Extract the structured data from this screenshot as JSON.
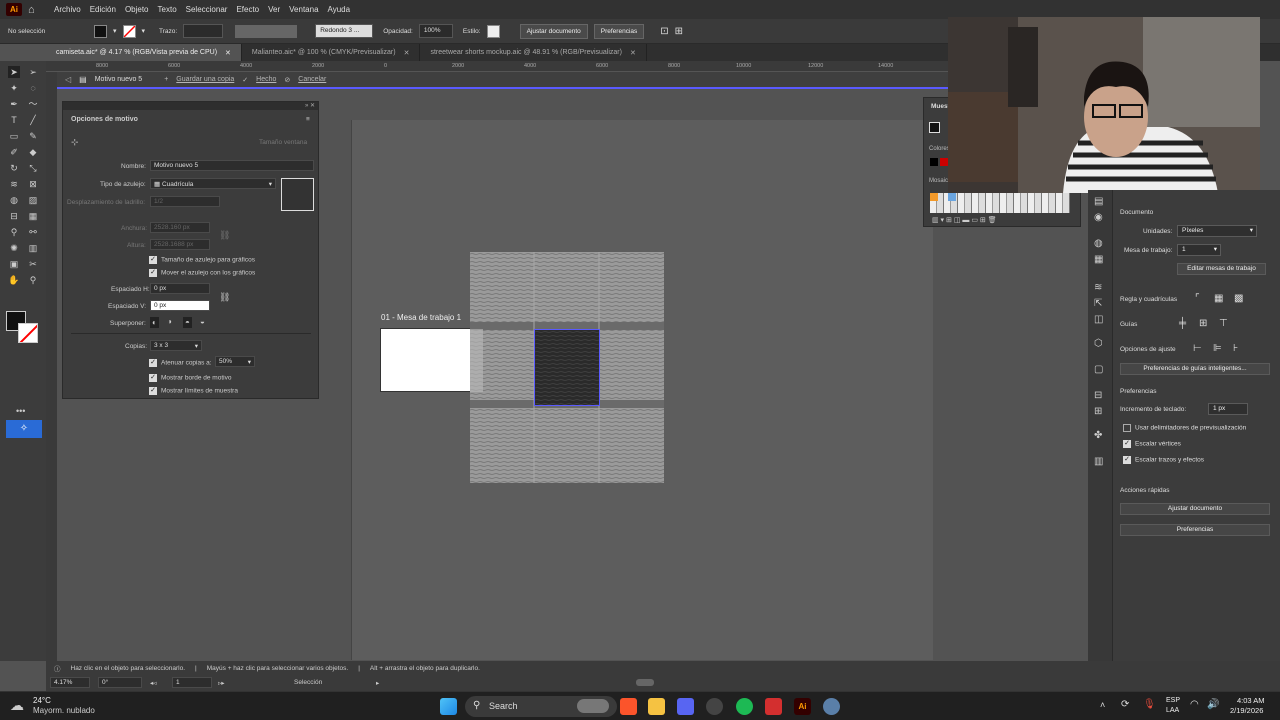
{
  "app": {
    "logo": "Ai"
  },
  "menu": [
    "Archivo",
    "Edición",
    "Objeto",
    "Texto",
    "Seleccionar",
    "Efecto",
    "Ver",
    "Ventana",
    "Ayuda"
  ],
  "control_bar": {
    "selection": "No selección",
    "stroke_label": "Trazo:",
    "brush": "Redondo 3 ...",
    "opacity_label": "Opacidad:",
    "opacity_value": "100%",
    "style_label": "Estilo:",
    "fit_doc": "Ajustar documento",
    "prefs": "Preferencias"
  },
  "tabs": [
    {
      "label": "camiseta.aic* @ 4.17 % (RGB/Vista previa de CPU)",
      "active": true
    },
    {
      "label": "Malianteo.aic* @ 100 % (CMYK/Previsualizar)",
      "active": false
    },
    {
      "label": "streetwear shorts mockup.aic @ 48.91 % (RGB/Previsualizar)",
      "active": false
    }
  ],
  "ruler_ticks": [
    "8000",
    "6000",
    "4000",
    "2000",
    "0",
    "2000",
    "4000",
    "6000",
    "8000",
    "10000",
    "12000",
    "14000"
  ],
  "isolation": {
    "title": "Motivo nuevo 5",
    "save_copy": "Guardar una copia",
    "done": "Hecho",
    "cancel": "Cancelar"
  },
  "pattern_options": {
    "title": "Opciones de motivo",
    "fit_label": "Tamaño ventana",
    "name_label": "Nombre:",
    "name_value": "Motivo nuevo 5",
    "tile_type_label": "Tipo de azulejo:",
    "tile_type_value": "Cuadrícula",
    "brick_offset_label": "Desplazamiento de ladrillo:",
    "brick_offset_value": "1/2",
    "width_label": "Anchura:",
    "width_value": "2528.160 px",
    "height_label": "Altura:",
    "height_value": "2528.1688 px",
    "size_to_art": "Tamaño de azulejo para gráficos",
    "move_tile": "Mover el azulejo con los gráficos",
    "h_spacing_label": "Espaciado H:",
    "h_spacing_value": "0 px",
    "v_spacing_label": "Espaciado V:",
    "v_spacing_value": "0 px",
    "overlap_label": "Superponer:",
    "copies_label": "Copias:",
    "copies_value": "3 x 3",
    "dim_copies": "Atenuar copias a:",
    "dim_value": "50%",
    "show_tile_edge": "Mostrar borde de motivo",
    "show_swatch_bounds": "Mostrar límites de muestra"
  },
  "artboard": {
    "label": "01 - Mesa de trabajo 1"
  },
  "swatches": {
    "title": "Muest",
    "colors_label": "Colores",
    "mosaic_label": "Mosaic"
  },
  "properties": {
    "document": "Documento",
    "units_label": "Unidades:",
    "units_value": "Píxeles",
    "artboard_label": "Mesa de trabajo:",
    "artboard_value": "1",
    "edit_artboards": "Editar mesas de trabajo",
    "rulers_grids": "Regla y cuadrículas",
    "guides": "Guías",
    "snap_options": "Opciones de ajuste",
    "smart_guides": "Preferencias de guías inteligentes...",
    "preferences": "Preferencias",
    "keyboard_inc_label": "Incremento de teclado:",
    "keyboard_inc_value": "1 px",
    "preview_bounds": "Usar delimitadores de previsualización",
    "scale_corners": "Escalar vértices",
    "scale_strokes": "Escalar trazos y efectos",
    "quick_actions": "Acciones rápidas",
    "fit_doc_btn": "Ajustar documento",
    "prefs_btn": "Preferencias"
  },
  "status": {
    "hint1": "Haz clic en el objeto para seleccionarlo.",
    "hint2": "Mayús + haz clic para seleccionar varios objetos.",
    "hint3": "Alt + arrastra el objeto para duplicarlo.",
    "zoom": "4.17%",
    "rotation": "0°",
    "artboard": "1",
    "mode": "Selección"
  },
  "taskbar": {
    "temp": "24°C",
    "weather": "Mayorm. nublado",
    "search": "Search",
    "lang1": "ESP",
    "lang2": "LAA",
    "time": "4:03 AM",
    "date": "2/19/2026"
  }
}
